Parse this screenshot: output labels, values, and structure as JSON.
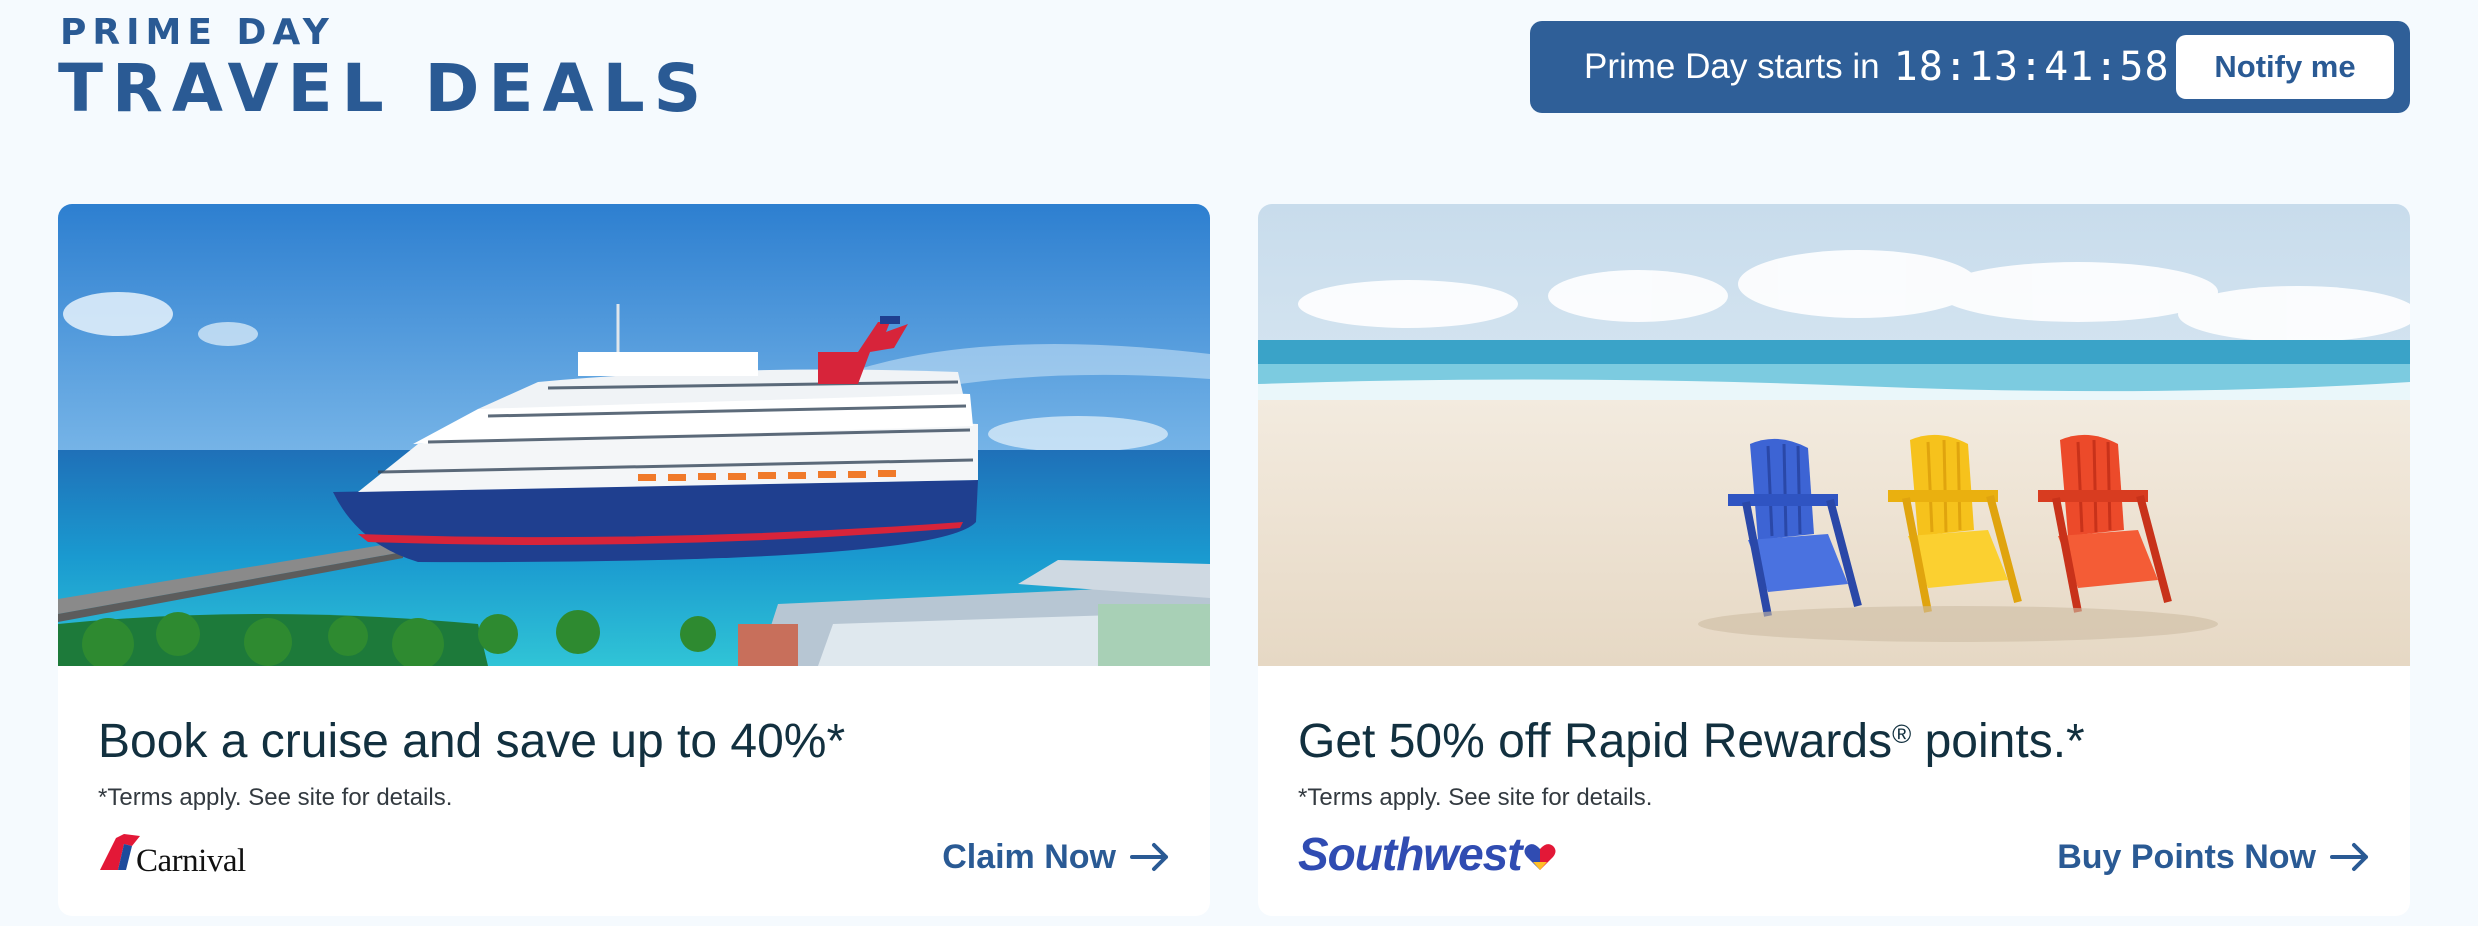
{
  "header": {
    "kicker": "PRIME DAY",
    "headline": "TRAVEL DEALS"
  },
  "countdown": {
    "label": "Prime Day starts in",
    "timer": "18:13:41:58",
    "notify_label": "Notify me"
  },
  "cards": [
    {
      "title": "Book a cruise and save up to 40%*",
      "terms": "*Terms apply. See site for details.",
      "cta_label": "Claim Now",
      "logo_text": "Carnival",
      "image": "cruise-ship-photo"
    },
    {
      "title_before": "Get 50% off Rapid Rewards",
      "title_mark": "®",
      "title_after": " points.*",
      "terms": "*Terms apply. See site for details.",
      "cta_label": "Buy Points Now",
      "logo_text": "Southwest",
      "image": "beach-chairs-photo"
    }
  ],
  "colors": {
    "brand_blue": "#2a5a94",
    "countdown_bg": "#2f5f98",
    "page_bg": "#f5fafe",
    "southwest_blue": "#304cb2",
    "carnival_red": "#e31837"
  },
  "icons": [
    "arrow-right-icon",
    "carnival-funnel-logo-icon",
    "southwest-heart-logo-icon"
  ]
}
